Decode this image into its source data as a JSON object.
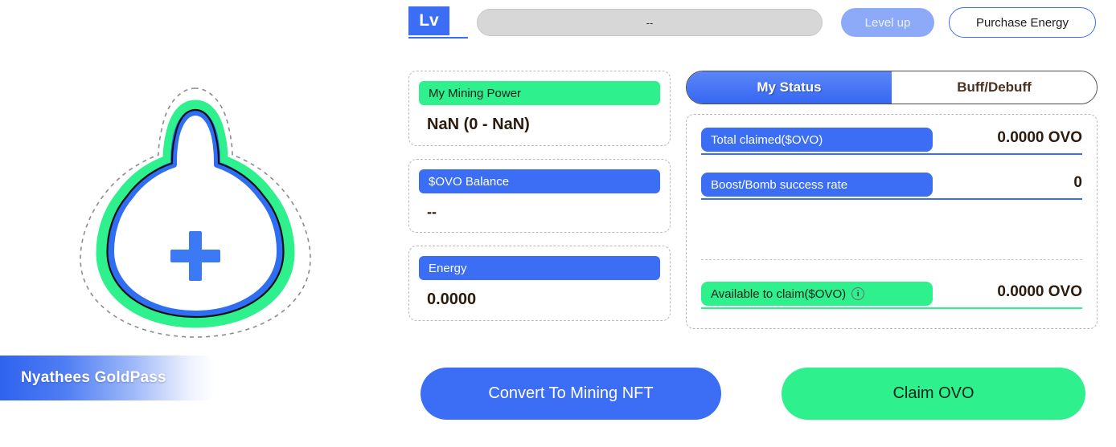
{
  "character": {
    "label": "Nyathees GoldPass",
    "plus_icon": "plus-icon",
    "colors": {
      "green": "#2ef08d",
      "blue": "#3b6ef5",
      "outline": "#111111"
    }
  },
  "topbar": {
    "level_badge": "Lv",
    "progress_value": "--",
    "level_up_label": "Level up",
    "purchase_energy_label": "Purchase Energy"
  },
  "cards": [
    {
      "title": "My Mining Power",
      "value": "NaN (0 - NaN)",
      "accent": "#2ef08d"
    },
    {
      "title": "$OVO Balance",
      "value": "--",
      "accent": "#3b6ef5"
    },
    {
      "title": "Energy",
      "value": "0.0000",
      "accent": "#3b6ef5"
    }
  ],
  "status": {
    "tabs": [
      {
        "label": "My Status",
        "active": true
      },
      {
        "label": "Buff/Debuff",
        "active": false
      }
    ],
    "rows": [
      {
        "label": "Total claimed($OVO)",
        "value": "0.0000 OVO",
        "accent": "#3b6ef5"
      },
      {
        "label": "Boost/Bomb success rate",
        "value": "0",
        "accent": "#3b6ef5"
      }
    ],
    "claim_row": {
      "label": "Available to claim($OVO)",
      "info_icon": "info-circle-icon",
      "value": "0.0000 OVO",
      "accent": "#2ef08d"
    }
  },
  "actions": {
    "convert_label": "Convert To Mining NFT",
    "claim_label": "Claim OVO"
  }
}
